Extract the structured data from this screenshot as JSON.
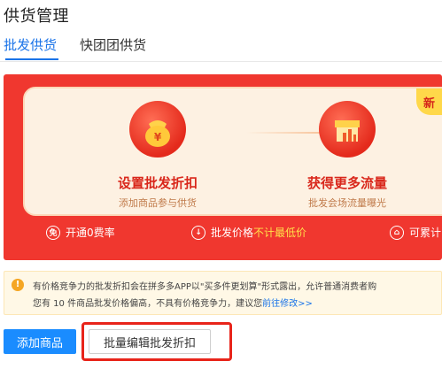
{
  "page": {
    "title": "供货管理"
  },
  "tabs": [
    {
      "label": "批发供货",
      "active": true
    },
    {
      "label": "快团团供货",
      "active": false
    }
  ],
  "banner": {
    "tag": "新",
    "steps": [
      {
        "title": "设置批发折扣",
        "subtitle": "添加商品参与供货",
        "icon": "money-bag-icon"
      },
      {
        "title": "获得更多流量",
        "subtitle": "批发会场流量曝光",
        "icon": "storefront-icon"
      }
    ],
    "features": [
      {
        "icon": "free-icon",
        "icon_text": "免",
        "text": "开通0费率"
      },
      {
        "icon": "down-arrow-circle-icon",
        "icon_text": "↓",
        "text_prefix": "批发价格",
        "text_highlight": "不计最低价"
      },
      {
        "icon": "house-icon",
        "icon_text": "⌂",
        "text": "可累计"
      }
    ],
    "colors": {
      "background": "#f0372f",
      "panel": "#fdf1e2",
      "accent": "#d9271b",
      "highlight": "#ffe14a"
    }
  },
  "notice": {
    "icon": "info-icon",
    "line1": "有价格竞争力的批发折扣会在拼多多APP以\"买多件更划算\"形式露出，允许普通消费者购",
    "line2_prefix": "您有 10 件商品批发价格偏高，不具有价格竞争力，建议您",
    "line2_link": "前往修改>>"
  },
  "actions": {
    "add_product": "添加商品",
    "batch_edit": "批量编辑批发折扣"
  }
}
